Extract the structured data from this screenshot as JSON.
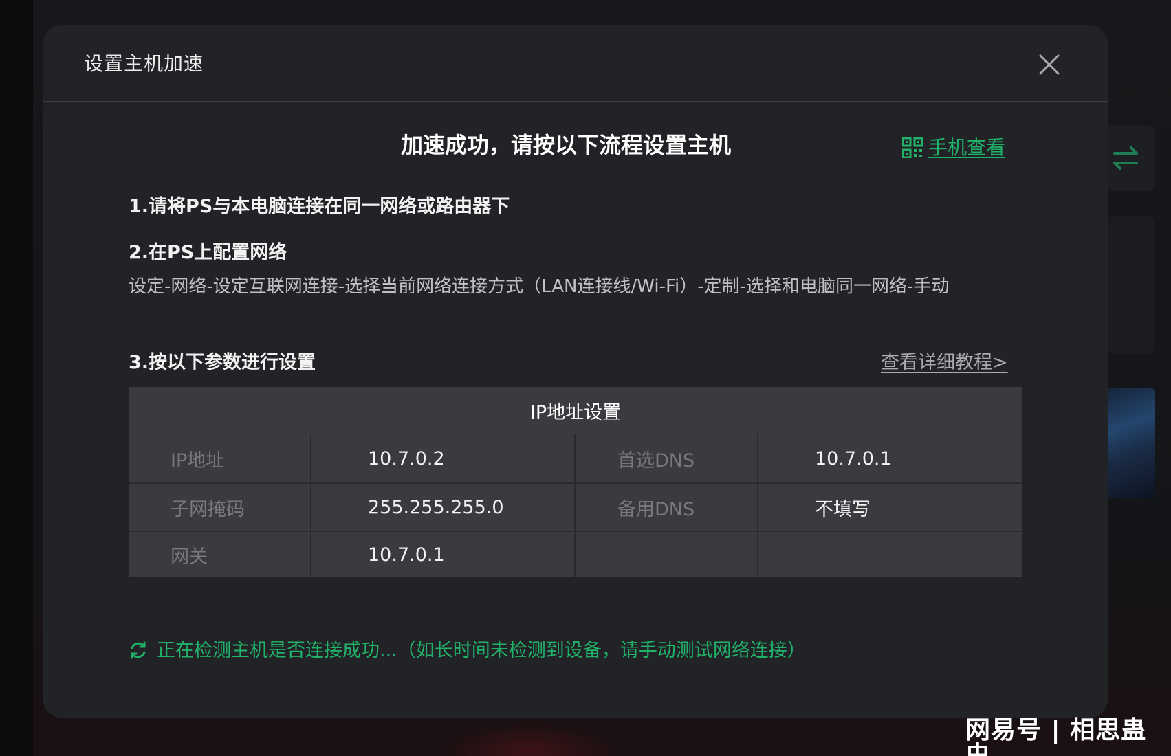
{
  "modal": {
    "title": "设置主机加速",
    "close_icon": "close-icon"
  },
  "headline": "加速成功，请按以下流程设置主机",
  "mobile_view": {
    "icon": "qr-code-icon",
    "label": "手机查看"
  },
  "steps": {
    "step1": "1.请将PS与本电脑连接在同一网络或路由器下",
    "step2": "2.在PS上配置网络",
    "step2_desc": "设定-网络-设定互联网连接-选择当前网络连接方式（LAN连接线/Wi-Fi）-定制-选择和电脑同一网络-手动",
    "step3": "3.按以下参数进行设置",
    "tutorial_link": "查看详细教程>"
  },
  "ip_table": {
    "header": "IP地址设置",
    "rows": [
      {
        "label": "IP地址",
        "value": "10.7.0.2",
        "label2": "首选DNS",
        "value2": "10.7.0.1"
      },
      {
        "label": "子网掩码",
        "value": "255.255.255.0",
        "label2": "备用DNS",
        "value2": "不填写"
      },
      {
        "label": "网关",
        "value": "10.7.0.1",
        "label2": "",
        "value2": ""
      }
    ]
  },
  "status": {
    "icon": "refresh-spinner-icon",
    "text": "正在检测主机是否连接成功...（如长时间未检测到设备，请手动测试网络连接）"
  },
  "watermark": "网易号 | 相思蛊虫",
  "colors": {
    "accent_green": "#21b26a",
    "modal_bg": "#222326",
    "table_bg": "#3a3b3f"
  }
}
